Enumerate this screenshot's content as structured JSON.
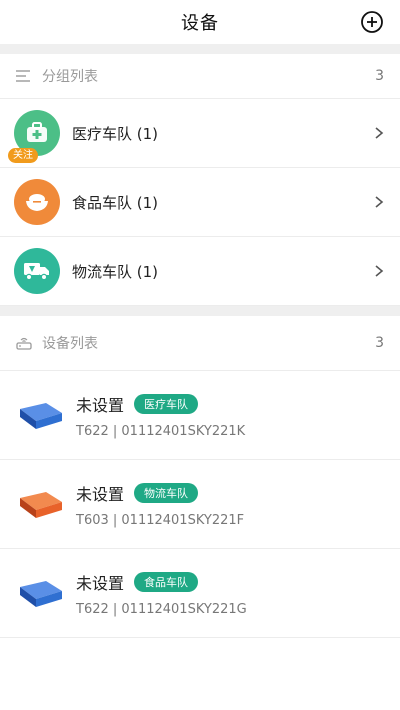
{
  "header": {
    "title": "设备"
  },
  "groups_section": {
    "title": "分组列表",
    "count": "3",
    "items": [
      {
        "label": "医疗车队 (1)",
        "icon": "medical-kit-icon",
        "color": "#4cbf87",
        "badge": "关注"
      },
      {
        "label": "食品车队 (1)",
        "icon": "food-bowl-icon",
        "color": "#f08a3a"
      },
      {
        "label": "物流车队 (1)",
        "icon": "delivery-truck-icon",
        "color": "#2fb89a"
      }
    ]
  },
  "devices_section": {
    "title": "设备列表",
    "count": "3",
    "items": [
      {
        "name": "未设置",
        "tag": "医疗车队",
        "sub": "T622 | 01112401SKY221K",
        "device_color": "#2f6fd1"
      },
      {
        "name": "未设置",
        "tag": "物流车队",
        "sub": "T603 | 01112401SKY221F",
        "device_color": "#e8622a"
      },
      {
        "name": "未设置",
        "tag": "食品车队",
        "sub": "T622 | 01112401SKY221G",
        "device_color": "#2f6fd1"
      }
    ]
  }
}
